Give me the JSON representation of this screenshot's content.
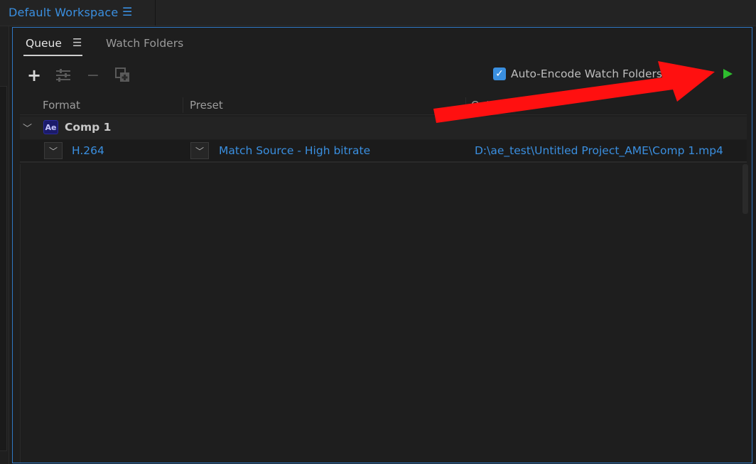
{
  "workspace": {
    "title": "Default Workspace",
    "menu_icon": "hamburger-menu-icon"
  },
  "tabs": [
    {
      "label": "Queue",
      "active": true
    },
    {
      "label": "Watch Folders",
      "active": false
    }
  ],
  "toolbar": {
    "add_icon": "plus-icon",
    "settings_icon": "sliders-icon",
    "remove_icon": "minus-icon",
    "duplicate_icon": "duplicate-icon",
    "auto_encode_label": "Auto-Encode Watch Folders",
    "auto_encode_checked": true,
    "start_icon": "play-icon"
  },
  "columns": {
    "format": "Format",
    "preset": "Preset",
    "output": "Output File"
  },
  "queue": {
    "comp": {
      "badge": "Ae",
      "name": "Comp 1",
      "output": {
        "format": "H.264",
        "preset": "Match Source - High bitrate",
        "file": "D:\\ae_test\\Untitled Project_AME\\Comp 1.mp4"
      }
    }
  },
  "colors": {
    "accent": "#3a8fe0",
    "play": "#2ebd2e",
    "annotation": "#ff1010"
  }
}
